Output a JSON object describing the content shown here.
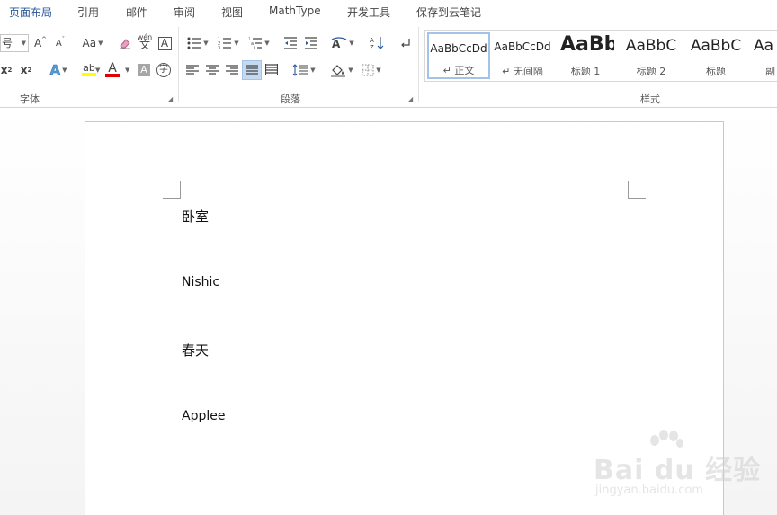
{
  "menubar": {
    "tabs": [
      {
        "label": "页面布局",
        "active": true
      },
      {
        "label": "引用"
      },
      {
        "label": "邮件"
      },
      {
        "label": "审阅"
      },
      {
        "label": "视图"
      },
      {
        "label": "MathType"
      },
      {
        "label": "开发工具"
      },
      {
        "label": "保存到云笔记"
      }
    ]
  },
  "ribbon": {
    "font_group": {
      "label": "字体",
      "font_size_value": "号",
      "grow_font": "A",
      "shrink_font": "A",
      "change_case": "Aa",
      "phonetic_guide": "wén",
      "phonetic_char": "文",
      "char_border": "A",
      "subscript": "x",
      "subscript_mark": "2",
      "superscript": "x",
      "superscript_mark": "2",
      "text_effects": "A",
      "highlight": "ab",
      "font_color": "A",
      "char_shading": "A",
      "enclose_char": "字",
      "highlight_color": "#ffff00",
      "font_color_value": "#e00000"
    },
    "paragraph_group": {
      "label": "段落"
    },
    "styles_group": {
      "label": "样式",
      "items": [
        {
          "sample": "AaBbCcDd",
          "name": "↵ 正文"
        },
        {
          "sample": "AaBbCcDd",
          "name": "↵ 无间隔"
        },
        {
          "sample": "AaBb",
          "name": "标题 1"
        },
        {
          "sample": "AaBbC",
          "name": "标题 2"
        },
        {
          "sample": "AaBbC",
          "name": "标题"
        },
        {
          "sample": "Aa",
          "name": "副"
        }
      ]
    }
  },
  "document": {
    "paragraphs": [
      "卧室",
      "Nishic",
      "春天",
      "Applee"
    ]
  },
  "watermark": {
    "brand": "Bai du 经验",
    "url": "jingyan.baidu.com"
  }
}
